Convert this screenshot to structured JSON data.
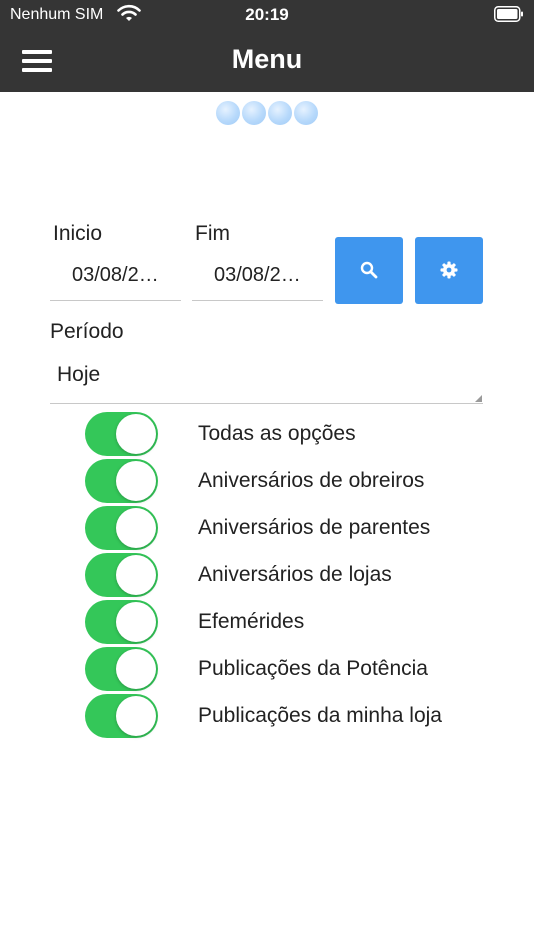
{
  "status_bar": {
    "carrier": "Nenhum SIM",
    "time": "20:19"
  },
  "header": {
    "title": "Menu",
    "menu_icon": "hamburger-icon"
  },
  "pager": {
    "dot_count": 4,
    "dot_color": "#b7d9fb"
  },
  "filters": {
    "start_label": "Inicio",
    "start_value": "03/08/2…",
    "end_label": "Fim",
    "end_value": "03/08/2…",
    "search_icon": "search-icon",
    "settings_icon": "gear-icon",
    "button_color": "#3f96ee"
  },
  "period": {
    "label": "Período",
    "selected": "Hoje"
  },
  "toggles": [
    {
      "label": "Todas as opções",
      "on": true
    },
    {
      "label": "Aniversários de obreiros",
      "on": true
    },
    {
      "label": "Aniversários de parentes",
      "on": true
    },
    {
      "label": "Aniversários de lojas",
      "on": true
    },
    {
      "label": "Efemérides",
      "on": true
    },
    {
      "label": "Publicações da Potência",
      "on": true
    },
    {
      "label": "Publicações da minha loja",
      "on": true
    }
  ],
  "colors": {
    "header_bg": "#353535",
    "toggle_on": "#34c759"
  }
}
